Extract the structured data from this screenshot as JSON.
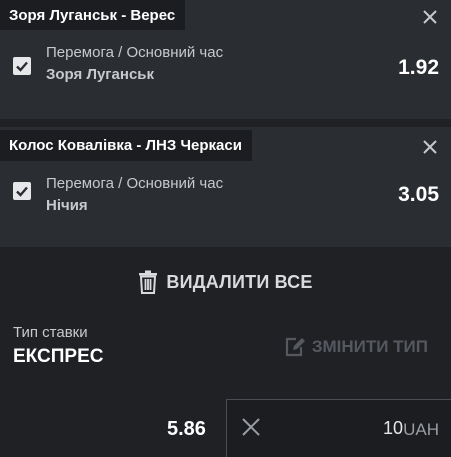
{
  "bets": [
    {
      "match": "Зоря Луганськ - Верес",
      "market": "Перемога / Основний час",
      "selection": "Зоря Луганськ",
      "odds": "1.92",
      "checked": true
    },
    {
      "match": "Колос Ковалівка - ЛНЗ Черкаси",
      "market": "Перемога / Основний час",
      "selection": "Нічия",
      "odds": "3.05",
      "checked": true
    }
  ],
  "actions": {
    "delete_all_label": "ВИДАЛИТИ ВСЕ",
    "change_type_label": "ЗМІНИТИ ТИП"
  },
  "bet_type": {
    "label": "Тип ставки",
    "value": "ЕКСПРЕС"
  },
  "summary": {
    "total_odds": "5.86",
    "stake_value": "10",
    "currency": "UAH"
  },
  "icons": {
    "close": "close-icon",
    "checkbox": "check-icon",
    "delete": "trash-icon",
    "edit": "edit-icon",
    "clear": "clear-icon"
  },
  "colors": {
    "background": "#1f2125",
    "card": "#2a2d32",
    "tab": "#1b1d21",
    "disabled": "#55585e"
  }
}
